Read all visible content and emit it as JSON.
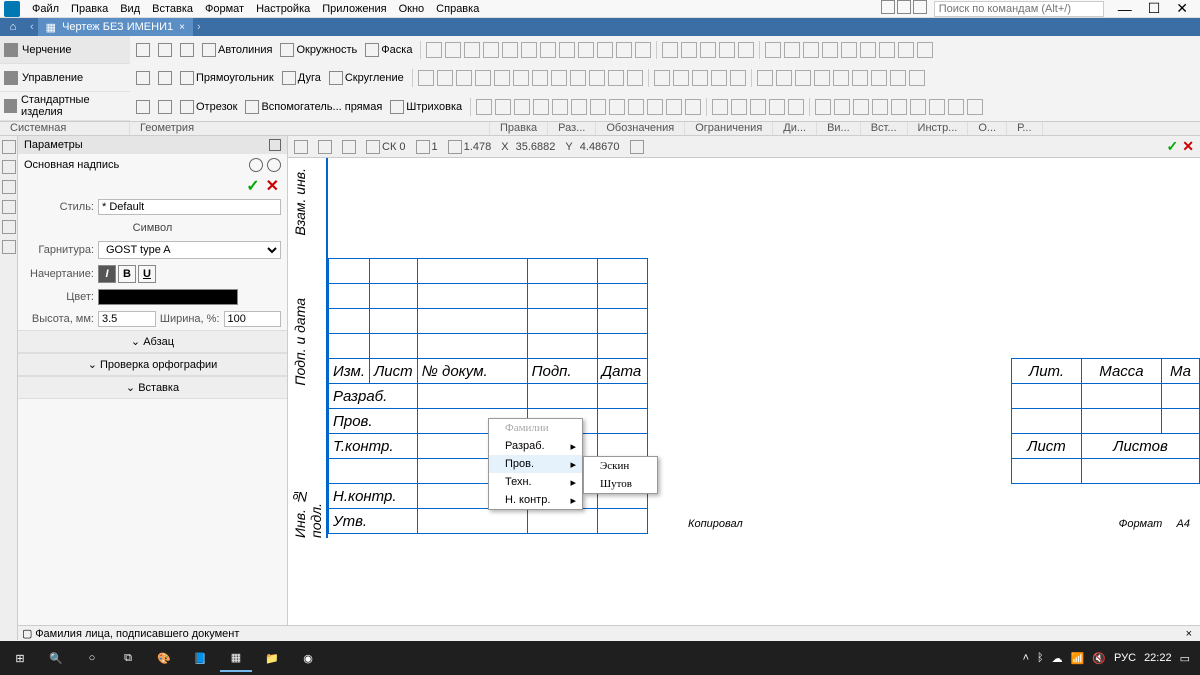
{
  "menu": {
    "items": [
      "Файл",
      "Правка",
      "Вид",
      "Вставка",
      "Формат",
      "Настройка",
      "Приложения",
      "Окно",
      "Справка"
    ],
    "search_placeholder": "Поиск по командам (Alt+/)"
  },
  "tab": {
    "home": "⌂",
    "title": "Чертеж БЕЗ ИМЕНИ1",
    "close": "×"
  },
  "ribbon_left": {
    "rows": [
      "Черчение",
      "Управление",
      "Стандартные изделия"
    ]
  },
  "ribbon_tools": {
    "row1": [
      "Автолиния",
      "Окружность",
      "Фаска"
    ],
    "row2": [
      "Прямоугольник",
      "Дуга",
      "Скругление"
    ],
    "row3": [
      "Отрезок",
      "Вспомогатель... прямая",
      "Штриховка"
    ]
  },
  "groups": [
    "Системная",
    "Геометрия",
    "Правка",
    "Раз...",
    "Обозначения",
    "Ограничения",
    "Ди...",
    "Ви...",
    "Вст...",
    "Инстр...",
    "О...",
    "Р..."
  ],
  "params": {
    "title": "Параметры",
    "subtitle": "Основная надпись",
    "style_label": "Стиль:",
    "style_value": "* Default",
    "symbol_heading": "Символ",
    "font_label": "Гарнитура:",
    "font_value": "GOST type A",
    "face_label": "Начертание:",
    "color_label": "Цвет:",
    "height_label": "Высота, мм:",
    "height_value": "3.5",
    "width_label": "Ширина, %:",
    "width_value": "100",
    "sections": [
      "Абзац",
      "Проверка орфографии",
      "Вставка"
    ]
  },
  "canvas_top": {
    "ck": "СК 0",
    "step": "1",
    "zoom": "1.478",
    "x_label": "X",
    "x": "35.6882",
    "y_label": "Y",
    "y": "4.48670"
  },
  "titleblock": {
    "vlabels": [
      "Взам. инв.",
      "Подп. и дата",
      "Инв. № подл."
    ],
    "headers": [
      "Изм.",
      "Лист",
      "№ докум.",
      "Подп.",
      "Дата"
    ],
    "roles": [
      "Разраб.",
      "Пров.",
      "Т.контр.",
      "",
      "Н.контр.",
      "Утв."
    ],
    "right_top": [
      "Лит.",
      "Масса",
      "Ма"
    ],
    "right_bot": [
      "Лист",
      "Листов"
    ],
    "copied": "Копировал",
    "format_lbl": "Формат",
    "format_val": "A4"
  },
  "popup1": {
    "header": "Фамилии",
    "items": [
      "Разраб.",
      "Пров.",
      "Техн.",
      "Н. контр."
    ]
  },
  "popup2": {
    "items": [
      "Эскин",
      "Шутов"
    ]
  },
  "status": {
    "text": "Фамилия лица, подписавшего документ"
  },
  "taskbar": {
    "lang": "РУС",
    "time": "22:22"
  }
}
